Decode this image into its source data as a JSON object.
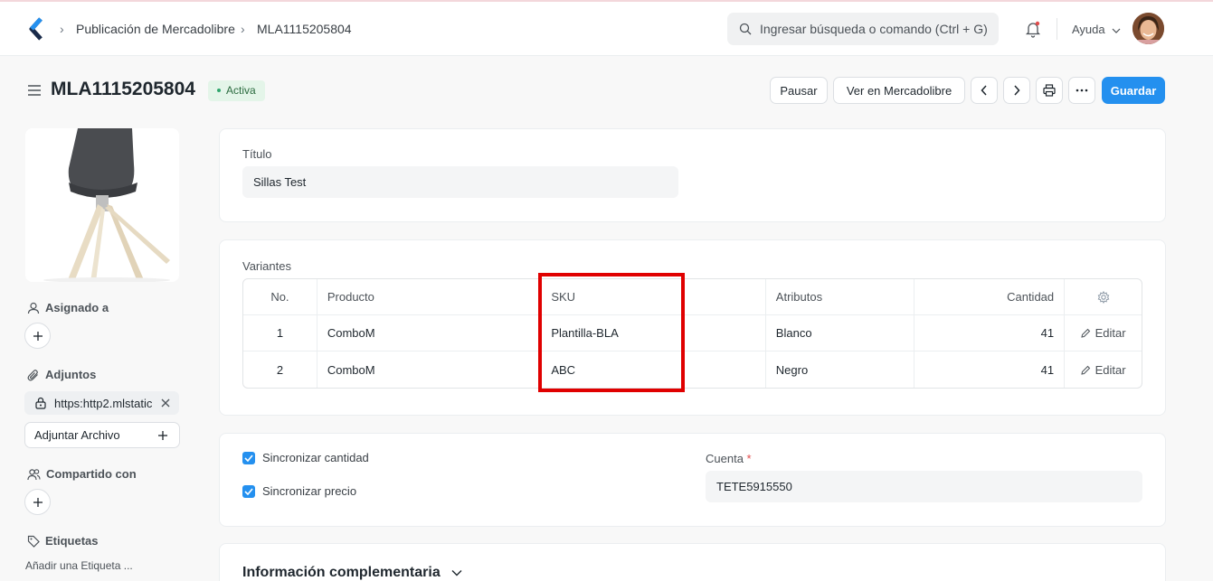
{
  "navbar": {
    "breadcrumbs": [
      "Publicación de Mercadolibre",
      "MLA1115205804"
    ],
    "search_placeholder": "Ingresar búsqueda o comando (Ctrl + G)",
    "help_label": "Ayuda"
  },
  "page": {
    "title": "MLA1115205804",
    "status": "Activa",
    "buttons": {
      "pause": "Pausar",
      "view_ml": "Ver en Mercadolibre",
      "save": "Guardar"
    }
  },
  "sidebar": {
    "assigned_label": "Asignado a",
    "attachments_label": "Adjuntos",
    "attachment_name": "https:http2.mlstatic.com",
    "attach_file_label": "Adjuntar Archivo",
    "shared_label": "Compartido con",
    "tags_label": "Etiquetas",
    "add_tag_label": "Añadir una Etiqueta ..."
  },
  "form": {
    "title_label": "Título",
    "title_value": "Sillas Test",
    "variants_label": "Variantes",
    "variants_columns": {
      "no": "No.",
      "product": "Producto",
      "sku": "SKU",
      "attributes": "Atributos",
      "quantity": "Cantidad"
    },
    "variants_rows": [
      {
        "no": "1",
        "product": "ComboM",
        "sku": "Plantilla-BLA",
        "attributes": "Blanco",
        "quantity": "41",
        "edit": "Editar"
      },
      {
        "no": "2",
        "product": "ComboM",
        "sku": "ABC",
        "attributes": "Negro",
        "quantity": "41",
        "edit": "Editar"
      }
    ],
    "sync_qty_label": "Sincronizar cantidad",
    "sync_price_label": "Sincronizar precio",
    "account_label": "Cuenta",
    "account_required_mark": "*",
    "account_value": "TETE5915550",
    "extra_section_title": "Información complementaria"
  },
  "colors": {
    "primary": "#2490ef",
    "status_green": "#30a66d",
    "highlight_red": "#e00000"
  }
}
